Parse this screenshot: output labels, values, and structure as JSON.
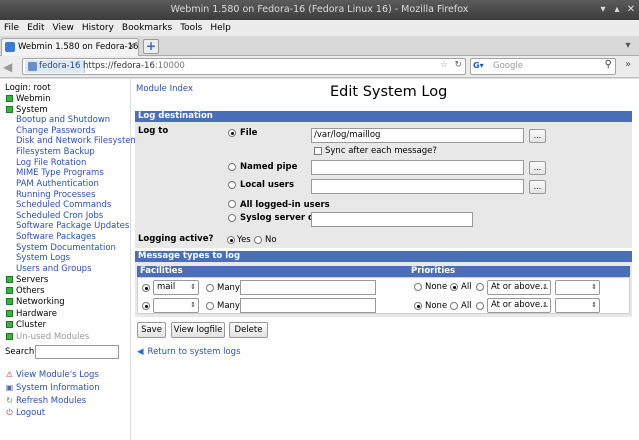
{
  "window": {
    "title": "Webmin 1.580 on Fedora-16 (Fedora Linux 16) - Mozilla Firefox"
  },
  "menubar": {
    "items": [
      "File",
      "Edit",
      "View",
      "History",
      "Bookmarks",
      "Tools",
      "Help"
    ]
  },
  "tab": {
    "label": "Webmin 1.580 on Fedora-16 (F...",
    "new_tab": "+"
  },
  "nav": {
    "site": "fedora-16",
    "url_host": "https://fedora-16",
    "url_port": ":10000",
    "search_engine": "G",
    "search_placeholder": "Google"
  },
  "sidebar": {
    "login": "Login: root",
    "categories_top": [
      "Webmin",
      "System"
    ],
    "system_modules": [
      "Bootup and Shutdown",
      "Change Passwords",
      "Disk and Network Filesystems",
      "Filesystem Backup",
      "Log File Rotation",
      "MIME Type Programs",
      "PAM Authentication",
      "Running Processes",
      "Scheduled Commands",
      "Scheduled Cron Jobs",
      "Software Package Updates",
      "Software Packages",
      "System Documentation",
      "System Logs",
      "Users and Groups"
    ],
    "categories_bottom": [
      "Servers",
      "Others",
      "Networking",
      "Hardware",
      "Cluster"
    ],
    "unused": "Un-used Modules",
    "search_label": "Search:",
    "links": [
      "View Module's Logs",
      "System Information",
      "Refresh Modules",
      "Logout"
    ]
  },
  "main": {
    "module_index": "Module Index",
    "title": "Edit System Log",
    "dest_header": "Log destination",
    "log_to": "Log to",
    "file_label": "File",
    "file_value": "/var/log/maillog",
    "browse": "...",
    "sync_label": "Sync after each message?",
    "named_pipe": "Named pipe",
    "local_users": "Local users",
    "all_logged_in": "All logged-in users",
    "syslog_server": "Syslog server on",
    "logging_active": "Logging active?",
    "yes": "Yes",
    "no": "No",
    "types_header": "Message types to log",
    "facilities": "Facilities",
    "priorities": "Priorities",
    "rows": [
      {
        "facility": "mail",
        "many": "Many",
        "none": "None",
        "all": "All",
        "level": "At or above..."
      },
      {
        "facility": "",
        "many": "Many",
        "none": "None",
        "all": "All",
        "level": "At or above..."
      }
    ],
    "buttons": {
      "save": "Save",
      "view_logfile": "View logfile",
      "delete": "Delete"
    },
    "return_link": "Return to system logs"
  }
}
